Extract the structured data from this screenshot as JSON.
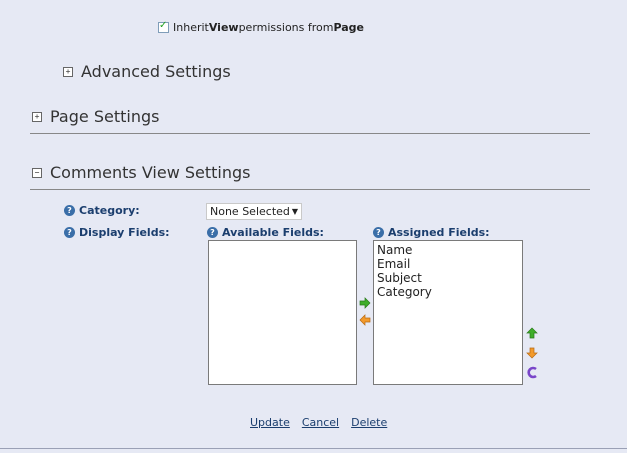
{
  "inherit": {
    "prefix": "Inherit ",
    "bold1": "View",
    "middle": " permissions from ",
    "bold2": "Page",
    "checked": true
  },
  "sections": {
    "advanced": "Advanced Settings",
    "page": "Page Settings",
    "comments": "Comments View Settings"
  },
  "expand_symbols": {
    "plus": "+",
    "minus": "−"
  },
  "labels": {
    "category": "Category:",
    "display_fields": "Display Fields:",
    "available": "Available Fields:",
    "assigned": "Assigned Fields:"
  },
  "help_glyph": "?",
  "category_select": {
    "value": "None Selected"
  },
  "assigned_fields": [
    "Name",
    "Email",
    "Subject",
    "Category"
  ],
  "actions": {
    "update": "Update",
    "cancel": "Cancel",
    "delete": "Delete"
  },
  "icons": {
    "move_right": "arrow-right-icon",
    "move_left": "arrow-left-icon",
    "move_up": "arrow-up-icon",
    "move_down": "arrow-down-icon",
    "clear": "clear-icon"
  }
}
